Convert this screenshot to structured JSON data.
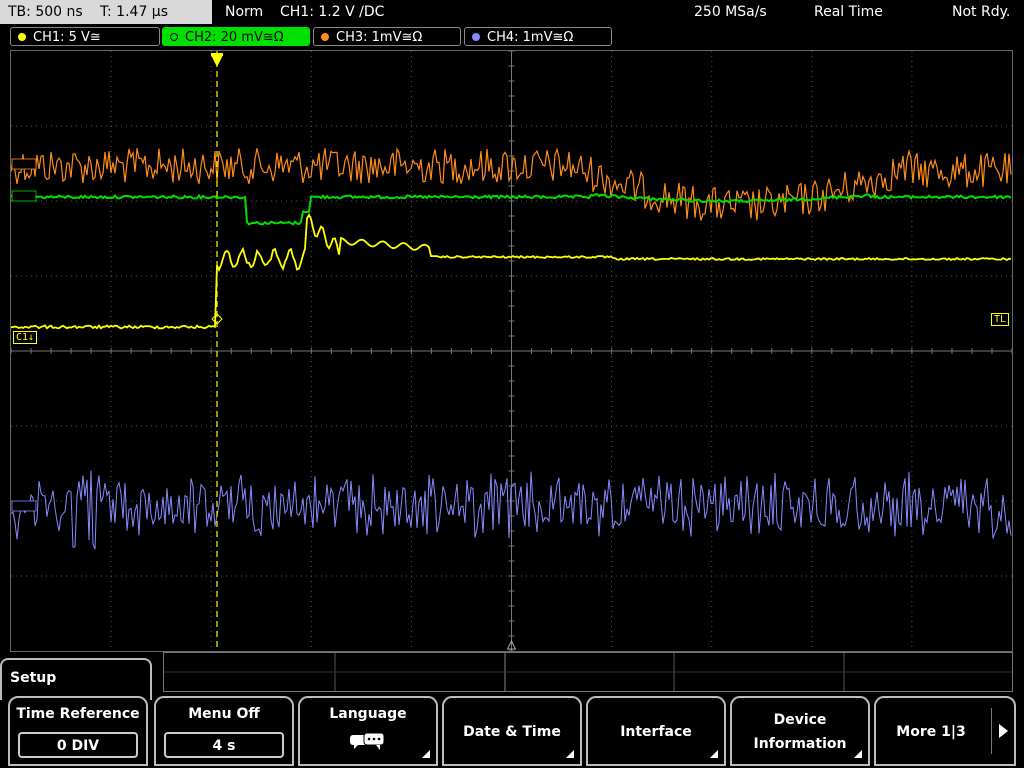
{
  "topbar": {
    "tb": "TB: 500 ns",
    "t": "T: 1.47 µs",
    "mode": "Norm",
    "trigger": "CH1: 1.2 V ∕DC",
    "sample_rate": "250 MSa/s",
    "acq": "Real Time",
    "status": "Not Rdy."
  },
  "channels": [
    {
      "label": "CH1: 5 V≅",
      "color": "#ffff00",
      "active": false
    },
    {
      "label": "CH2: 20 mV≅Ω",
      "color": "#00e000",
      "active": true
    },
    {
      "label": "CH3: 1mV≅Ω",
      "color": "#ff8c1a",
      "active": false
    },
    {
      "label": "CH4: 1mV≅Ω",
      "color": "#8888ff",
      "active": false
    }
  ],
  "markers": {
    "c1": "C1↓",
    "tl": "TL"
  },
  "menu": {
    "title": "Setup",
    "keys": [
      {
        "label": "Time Reference",
        "value": "0 DIV"
      },
      {
        "label": "Menu Off",
        "value": "4 s"
      },
      {
        "label": "Language",
        "icon": "speech-bubbles-icon"
      },
      {
        "label": "Date & Time"
      },
      {
        "label": "Interface"
      },
      {
        "label": "Device",
        "label2": "Information"
      },
      {
        "label": "More 1|3"
      }
    ]
  },
  "colors": {
    "ch1": "#ffff00",
    "ch2": "#00e000",
    "ch3": "#ff8c1a",
    "ch4": "#8888ff",
    "grid": "#555555"
  }
}
